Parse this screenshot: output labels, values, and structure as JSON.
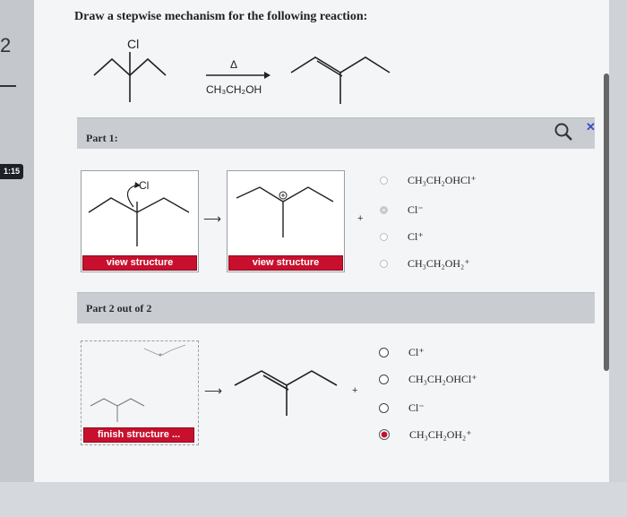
{
  "question": {
    "title": "Draw a stepwise mechanism for the following reaction:",
    "reactant_atom": "Cl",
    "arrow_top": "Δ",
    "arrow_bottom": "CH₃CH₂OH"
  },
  "sidebar": {
    "timer": "1:15"
  },
  "part1": {
    "label": "Part 1:",
    "chloride_label": "Cl",
    "view_button_1": "view structure",
    "view_button_2": "view structure",
    "options": [
      {
        "text": "CH₃CH₂OHCl⁺",
        "selected": false
      },
      {
        "text": "Cl⁻",
        "selected": true
      },
      {
        "text": "Cl⁺",
        "selected": false
      },
      {
        "text": "CH₃CH₂OH₂⁺",
        "selected": false
      }
    ]
  },
  "part2": {
    "label": "Part 2 out of 2",
    "finish_button": "finish structure ...",
    "options": [
      {
        "text": "Cl⁺",
        "selected": false
      },
      {
        "text": "CH₃CH₂OHCl⁺",
        "selected": false
      },
      {
        "text": "Cl⁻",
        "selected": false
      },
      {
        "text": "CH₃CH₂OH₂⁺",
        "selected": true
      }
    ]
  },
  "symbols": {
    "plus": "+",
    "arrow": "⟶"
  },
  "colors": {
    "accent_red": "#c8102e",
    "bar_grey": "#c9cdd2",
    "close_blue": "#3a4cc9"
  },
  "icons": {
    "search": "search-icon",
    "close": "close-icon"
  }
}
